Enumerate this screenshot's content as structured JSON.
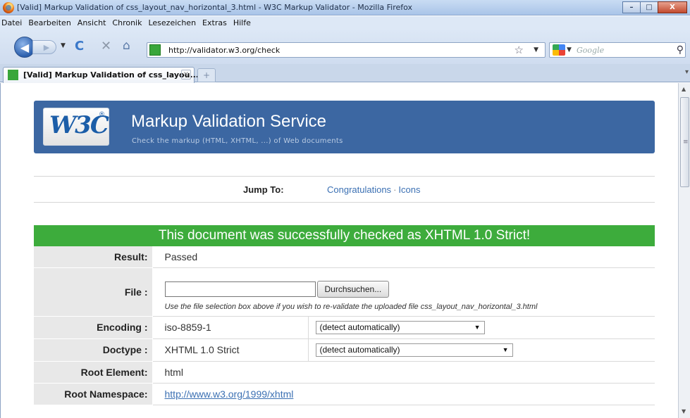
{
  "window": {
    "title": "[Valid] Markup Validation of css_layout_nav_horizontal_3.html - W3C Markup Validator - Mozilla Firefox",
    "buttons": {
      "minimize": "–",
      "maximize": "□",
      "close": "X"
    }
  },
  "menu": [
    "Datei",
    "Bearbeiten",
    "Ansicht",
    "Chronik",
    "Lesezeichen",
    "Extras",
    "Hilfe"
  ],
  "nav": {
    "back": "◀",
    "forward": "▶",
    "url": "http://validator.w3.org/check",
    "search_placeholder": "Google"
  },
  "tabs": [
    {
      "label": "[Valid] Markup Validation of css_layou...",
      "active": true
    }
  ],
  "page": {
    "banner": {
      "logo": "W3C",
      "logo_reg": "®",
      "title": "Markup Validation Service",
      "subtitle": "Check the markup (HTML, XHTML, ...) of Web documents"
    },
    "jump": {
      "label": "Jump To:",
      "links": [
        "Congratulations",
        "Icons"
      ],
      "separator": "·"
    },
    "result_heading": "This document was successfully checked as XHTML 1.0 Strict!",
    "rows": {
      "result": {
        "label": "Result:",
        "value": "Passed"
      },
      "file": {
        "label": "File :",
        "button": "Durchsuchen...",
        "hint": "Use the file selection box above if you wish to re-validate the uploaded file css_layout_nav_horizontal_3.html"
      },
      "encoding": {
        "label": "Encoding :",
        "value": "iso-8859-1",
        "select": "(detect automatically)"
      },
      "doctype": {
        "label": "Doctype :",
        "value": "XHTML 1.0 Strict",
        "select": "(detect automatically)"
      },
      "root_element": {
        "label": "Root Element:",
        "value": "html"
      },
      "root_namespace": {
        "label": "Root Namespace:",
        "value": "http://www.w3.org/1999/xhtml"
      }
    }
  },
  "colors": {
    "banner": "#3c67a2",
    "success": "#3dac3c",
    "link": "#3b70b3"
  }
}
